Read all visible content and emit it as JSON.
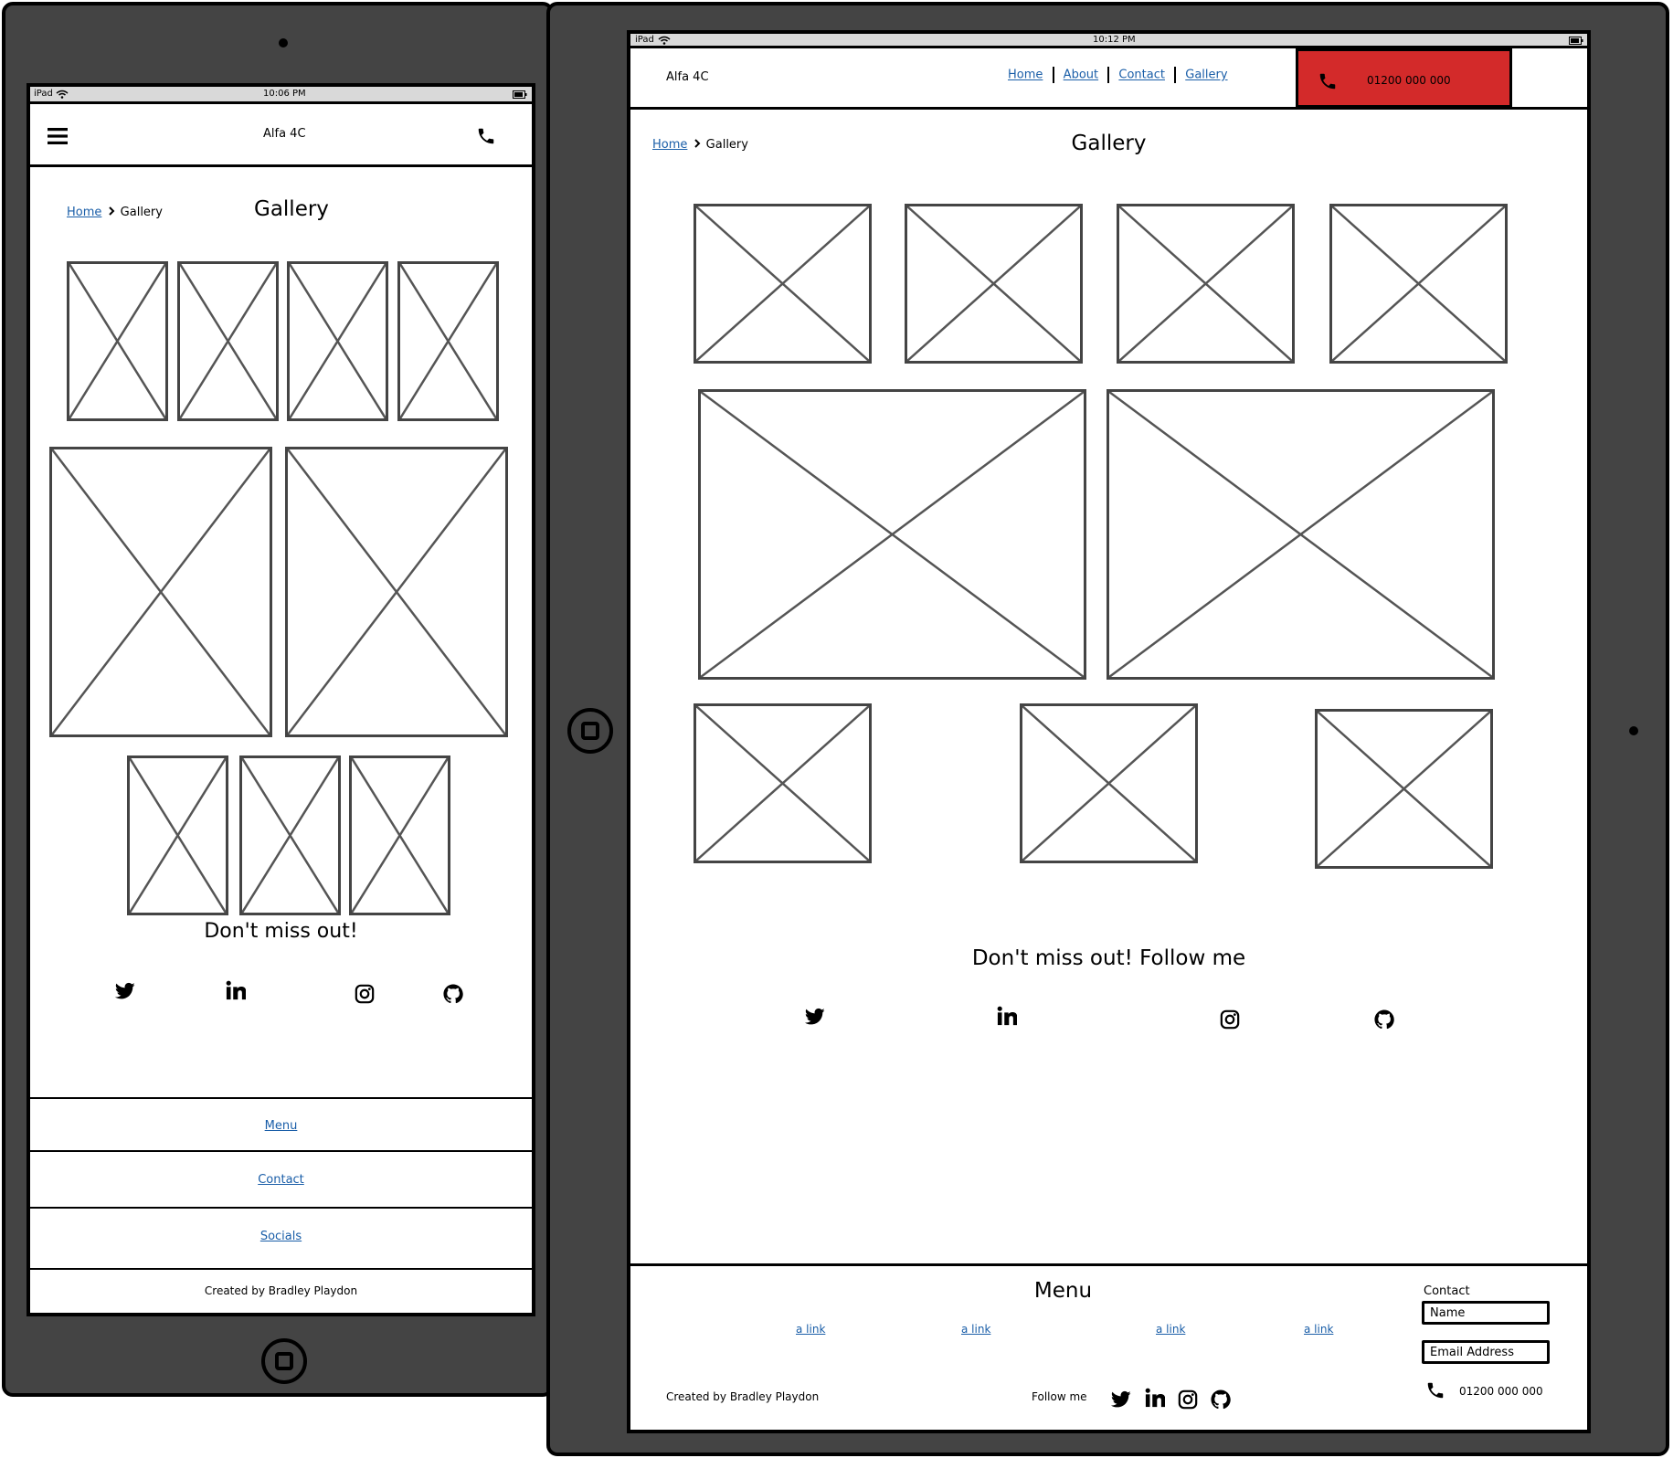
{
  "phone": {
    "status": {
      "device": "iPad",
      "time": "10:06 PM"
    },
    "header": {
      "title": "Alfa 4C"
    },
    "breadcrumb": {
      "home": "Home",
      "current": "Gallery"
    },
    "page_title": "Gallery",
    "social_heading": "Don't miss out!",
    "footer_links": [
      "Menu",
      "Contact",
      "Socials"
    ],
    "credit": "Created by Bradley Playdon"
  },
  "tablet": {
    "status": {
      "device": "iPad",
      "time": "10:12 PM"
    },
    "header": {
      "title": "Alfa 4C",
      "nav": [
        "Home",
        "About",
        "Contact",
        "Gallery"
      ],
      "phone_number": "01200 000 000"
    },
    "breadcrumb": {
      "home": "Home",
      "current": "Gallery"
    },
    "page_title": "Gallery",
    "social_heading": "Don't miss out! Follow me",
    "footer": {
      "menu_title": "Menu",
      "links": [
        "a link",
        "a link",
        "a link",
        "a link"
      ],
      "credit": "Created by Bradley Playdon",
      "follow_label": "Follow me",
      "contact_title": "Contact",
      "name_field": "Name",
      "email_field": "Email Address",
      "phone_number": "01200 000 000"
    }
  },
  "colors": {
    "device_body": "#444444",
    "call_button": "#d32a2a",
    "link": "#1a5ea8",
    "status_bar": "#d9d9d9"
  },
  "icons": [
    "menu-icon",
    "phone-icon",
    "twitter-icon",
    "linkedin-icon",
    "instagram-icon",
    "github-icon",
    "wifi-icon",
    "battery-icon",
    "chevron-right-icon",
    "home-button-icon"
  ]
}
